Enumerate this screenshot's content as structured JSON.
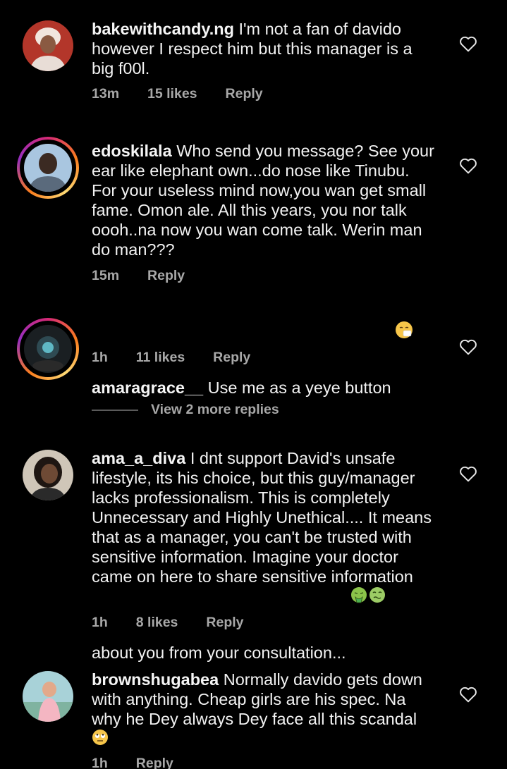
{
  "comments": [
    {
      "username": "bakewithcandy.ng",
      "text": "I'm not a fan of davido\nhowever I respect him but this manager is a\nbig f00l.",
      "time": "13m",
      "likes": "15 likes",
      "reply": "Reply",
      "has_story_ring": false
    },
    {
      "username": "edoskilala",
      "text": "Who send you message? See your\near like elephant own...do nose like Tinubu.\nFor your useless mind now,you wan get small\nfame. Omon ale. All this years, you nor talk\noooh..na now you wan come talk. Werin man\ndo man???",
      "time": "15m",
      "likes": "",
      "reply": "Reply",
      "has_story_ring": true
    },
    {
      "username": "amaragrace__",
      "text": "Use me as a yeye button",
      "time": "1h",
      "likes": "11 likes",
      "reply": "Reply",
      "has_story_ring": true
    },
    {
      "username": "ama_a_diva",
      "text": "I dnt support David's unsafe\nlifestyle, its his choice, but this guy/manager\nlacks professionalism. This is completely\nUnnecessary and Highly Unethical.... It means\nthat as a manager, you can't be trusted with\nsensitive information. Imagine your doctor\ncame on here to share sensitive information\nabout you from your consultation...",
      "time": "1h",
      "likes": "8 likes",
      "reply": "Reply",
      "has_story_ring": false
    },
    {
      "username": "brownshugabea",
      "text": "Normally davido gets down\nwith anything. Cheap girls are his spec. Na\nwhy he Dey always Dey face all this scandal",
      "time": "1h",
      "likes": "",
      "reply": "Reply",
      "has_story_ring": false
    }
  ],
  "view_more_replies": "View 2 more replies",
  "icons": {
    "like": "heart-outline-icon",
    "emoji_sneezing": "sneezing-face-emoji",
    "emoji_vomiting": "vomiting-face-emoji",
    "emoji_nauseated": "nauseated-face-emoji",
    "emoji_eye_roll": "face-with-rolling-eyes-emoji"
  },
  "colors": {
    "background": "#000000",
    "text": "#f2f2f2",
    "meta": "#a8a8a8",
    "story_ring": "#d62976"
  }
}
